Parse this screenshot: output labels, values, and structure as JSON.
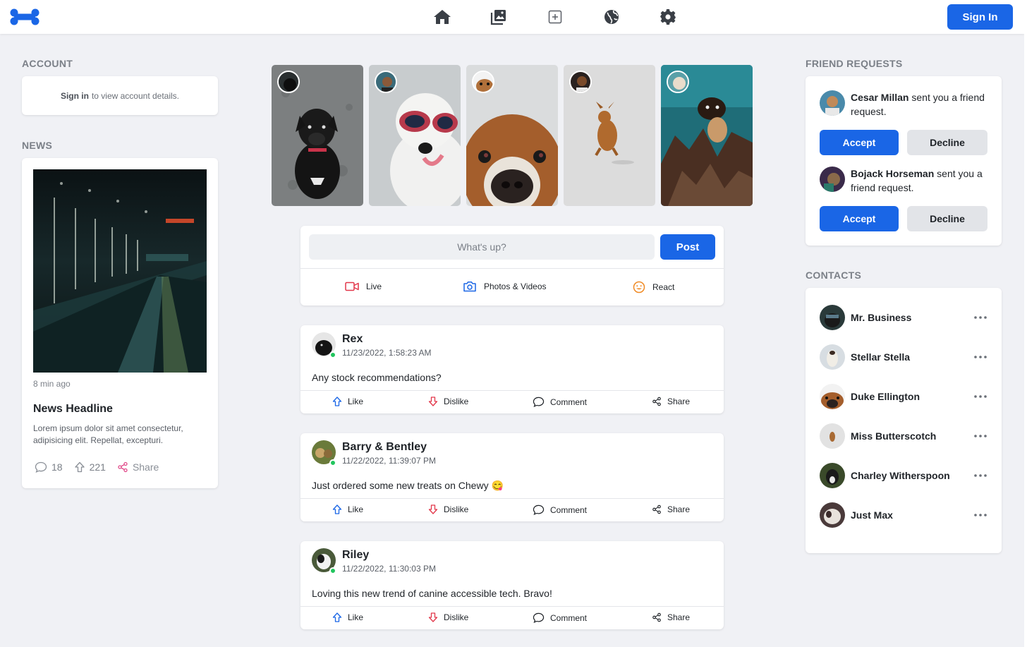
{
  "header": {
    "nav_icons": [
      "home-icon",
      "gallery-icon",
      "add-post-icon",
      "globe-icon",
      "settings-icon"
    ],
    "signin_label": "Sign In",
    "brand_color": "#1a66e6"
  },
  "account": {
    "label": "ACCOUNT",
    "signin_link": "Sign in",
    "message": "to view account details."
  },
  "news": {
    "label": "NEWS",
    "time": "8 min ago",
    "headline": "News Headline",
    "body": "Lorem ipsum dolor sit amet consectetur, adipisicing elit. Repellat, excepturi.",
    "comments": "18",
    "upvotes": "221",
    "share_label": "Share"
  },
  "composer": {
    "placeholder": "What's up?",
    "post_label": "Post",
    "actions": [
      {
        "label": "Live",
        "icon": "video-camera-icon"
      },
      {
        "label": "Photos & Videos",
        "icon": "camera-icon"
      },
      {
        "label": "React",
        "icon": "smiley-icon"
      }
    ]
  },
  "post_actions": {
    "like": "Like",
    "dislike": "Dislike",
    "comment": "Comment",
    "share": "Share"
  },
  "posts": [
    {
      "author": "Rex",
      "date": "11/23/2022, 1:58:23 AM",
      "text": "Any stock recommendations?"
    },
    {
      "author": "Barry & Bentley",
      "date": "11/22/2022, 11:39:07 PM",
      "text": "Just ordered some new treats on Chewy 😋"
    },
    {
      "author": "Riley",
      "date": "11/22/2022, 11:30:03 PM",
      "text": "Loving this new trend of canine accessible tech. Bravo!"
    }
  ],
  "friend_requests": {
    "label": "FRIEND REQUESTS",
    "suffix": "sent you a friend request.",
    "accept_label": "Accept",
    "decline_label": "Decline",
    "items": [
      {
        "name": "Cesar Millan"
      },
      {
        "name": "Bojack Horseman"
      }
    ]
  },
  "contacts": {
    "label": "CONTACTS",
    "items": [
      {
        "name": "Mr. Business"
      },
      {
        "name": "Stellar Stella"
      },
      {
        "name": "Duke Ellington"
      },
      {
        "name": "Miss Butterscotch"
      },
      {
        "name": "Charley Witherspoon"
      },
      {
        "name": "Just Max"
      }
    ]
  }
}
